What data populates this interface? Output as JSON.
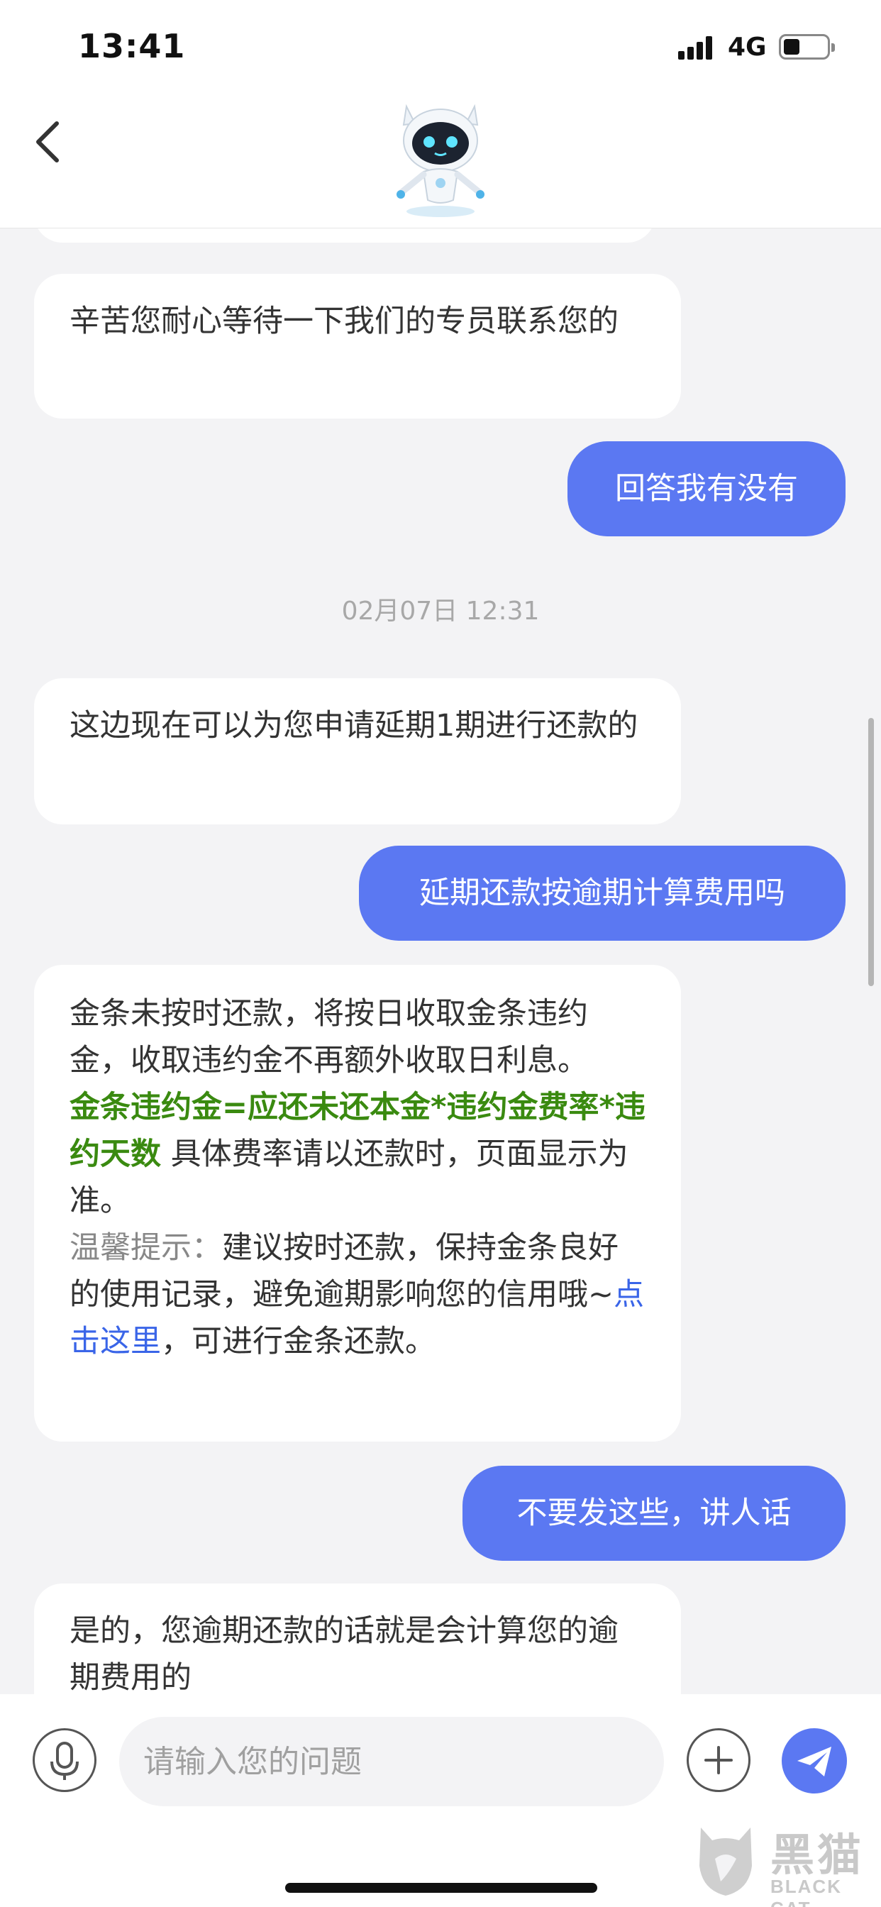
{
  "status_bar": {
    "time": "13:41",
    "network": "4G"
  },
  "nav": {
    "avatar_icon": "robot-assistant-icon",
    "back_icon": "chevron-left-icon"
  },
  "messages": [
    {
      "side": "left",
      "text": "辛苦您耐心等待一下我们的专员联系您的"
    },
    {
      "side": "right",
      "text": "回答我有没有"
    },
    {
      "type": "time",
      "text": "02月07日 12:31"
    },
    {
      "side": "left",
      "text": "这边现在可以为您申请延期1期进行还款的"
    },
    {
      "side": "right",
      "text": "延期还款按逾期计算费用吗"
    },
    {
      "side": "left",
      "intro": "金条未按时还款，将按日收取金条违约金，收取违约金不再额外收取日利息。",
      "formula": "金条违约金=应还未还本金*违约金费率*违约天数",
      "formula_note": " 具体费率请以还款时，页面显示为准。",
      "tip_label": "温馨提示：",
      "tip_text": "建议按时还款，保持金条良好的使用记录，避免逾期影响您的信用哦~",
      "link_text": "点击这里",
      "link_suffix": "，可进行金条还款。"
    },
    {
      "side": "right",
      "text": "不要发这些，讲人话"
    },
    {
      "side": "left",
      "text": "是的，您逾期还款的话就是会计算您的逾期费用的"
    }
  ],
  "input": {
    "placeholder": "请输入您的问题"
  },
  "watermark": {
    "text": "黑猫",
    "sub": "BLACK CAT"
  },
  "colors": {
    "accent": "#5b78f2",
    "green_text": "#3a8a10",
    "link": "#3a65e8",
    "background": "#f3f3f5"
  }
}
